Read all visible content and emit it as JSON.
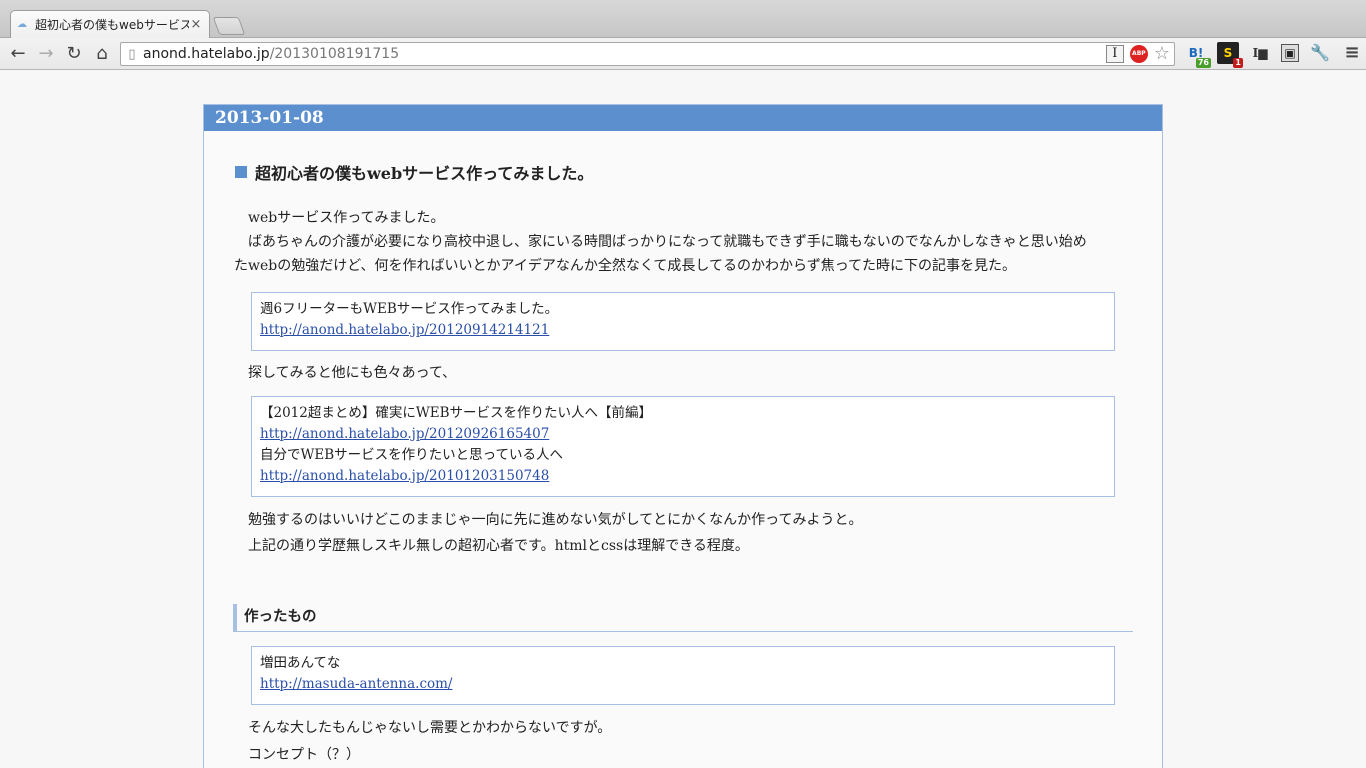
{
  "browser": {
    "tab_title": "超初心者の僕もwebサービス作",
    "tab_close": "×",
    "url_host": "anond.hatelabo.jp",
    "url_path": "/20130108191715",
    "abp_label": "ABP",
    "ext_hatena_label": "B!",
    "ext_hatena_count": "76",
    "ext_s_label": "S",
    "ext_s_count": "1"
  },
  "page": {
    "date": "2013-01-08",
    "entry_title": "超初心者の僕もwebサービス作ってみました。",
    "intro": [
      "webサービス作ってみました。",
      "ばあちゃんの介護が必要になり高校中退し、家にいる時間ばっかりになって就職もできず手に職もないのでなんかしなきゃと思い始め",
      "たwebの勉強だけど、何を作ればいいとかアイデアなんか全然なくて成長してるのかわからず焦ってた時に下の記事を見た。"
    ],
    "quote1": {
      "title": "週6フリーターもWEBサービス作ってみました。",
      "link": "http://anond.hatelabo.jp/20120914214121"
    },
    "middle": "探してみると他にも色々あって、",
    "quote2": {
      "title1": "【2012超まとめ】確実にWEBサービスを作りたい人へ【前編】",
      "link1": "http://anond.hatelabo.jp/20120926165407",
      "title2": "自分でWEBサービスを作りたいと思っている人へ",
      "link2": "http://anond.hatelabo.jp/20101203150748"
    },
    "para2": [
      "勉強するのはいいけどこのままじゃ一向に先に進めない気がしてとにかくなんか作ってみようと。",
      "上記の通り学歴無しスキル無しの超初心者です。htmlとcssは理解できる程度。"
    ],
    "subhead": "作ったもの",
    "quote3": {
      "title": "増田あんてな",
      "link": "http://masuda-antenna.com/"
    },
    "para3": [
      "そんな大したもんじゃないし需要とかわからないですが。",
      "コンセプト（？）"
    ]
  }
}
